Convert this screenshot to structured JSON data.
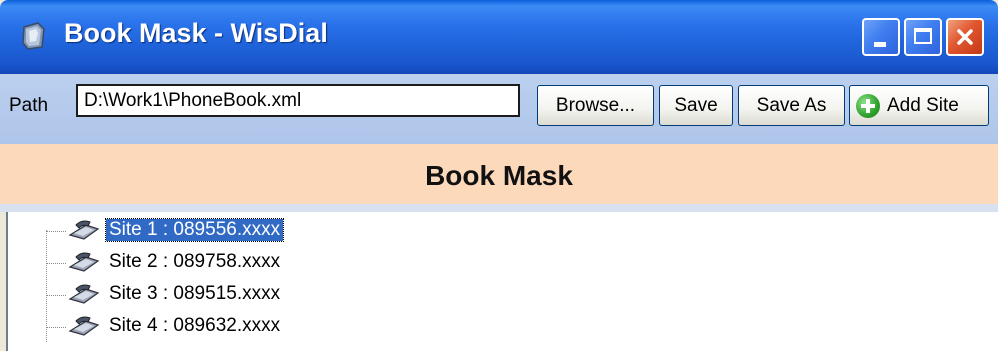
{
  "window": {
    "title": "Book Mask - WisDial",
    "icon": "app-icon",
    "caption_buttons": [
      "minimize-icon",
      "maximize-icon",
      "close-icon"
    ]
  },
  "toolbar": {
    "path_label": "Path",
    "path_value": "D:\\Work1\\PhoneBook.xml",
    "browse_label": "Browse...",
    "save_label": "Save",
    "save_as_label": "Save As",
    "add_site_label": "Add Site",
    "add_site_icon": "plus-circle-icon"
  },
  "header": {
    "title": "Book Mask"
  },
  "tree": {
    "items": [
      {
        "label": "Site 1 : 089556.xxxx",
        "selected": true,
        "icon": "phone-icon"
      },
      {
        "label": "Site 2 : 089758.xxxx",
        "selected": false,
        "icon": "phone-icon"
      },
      {
        "label": "Site 3 : 089515.xxxx",
        "selected": false,
        "icon": "phone-icon"
      },
      {
        "label": "Site 4 : 089632.xxxx",
        "selected": false,
        "icon": "phone-icon"
      }
    ]
  },
  "colors": {
    "title_bar": "#2b74ec",
    "toolbar_bg": "#b4cbed",
    "header_band": "#fdd9bb",
    "selection": "#316ac5",
    "close_button": "#e0562e"
  }
}
